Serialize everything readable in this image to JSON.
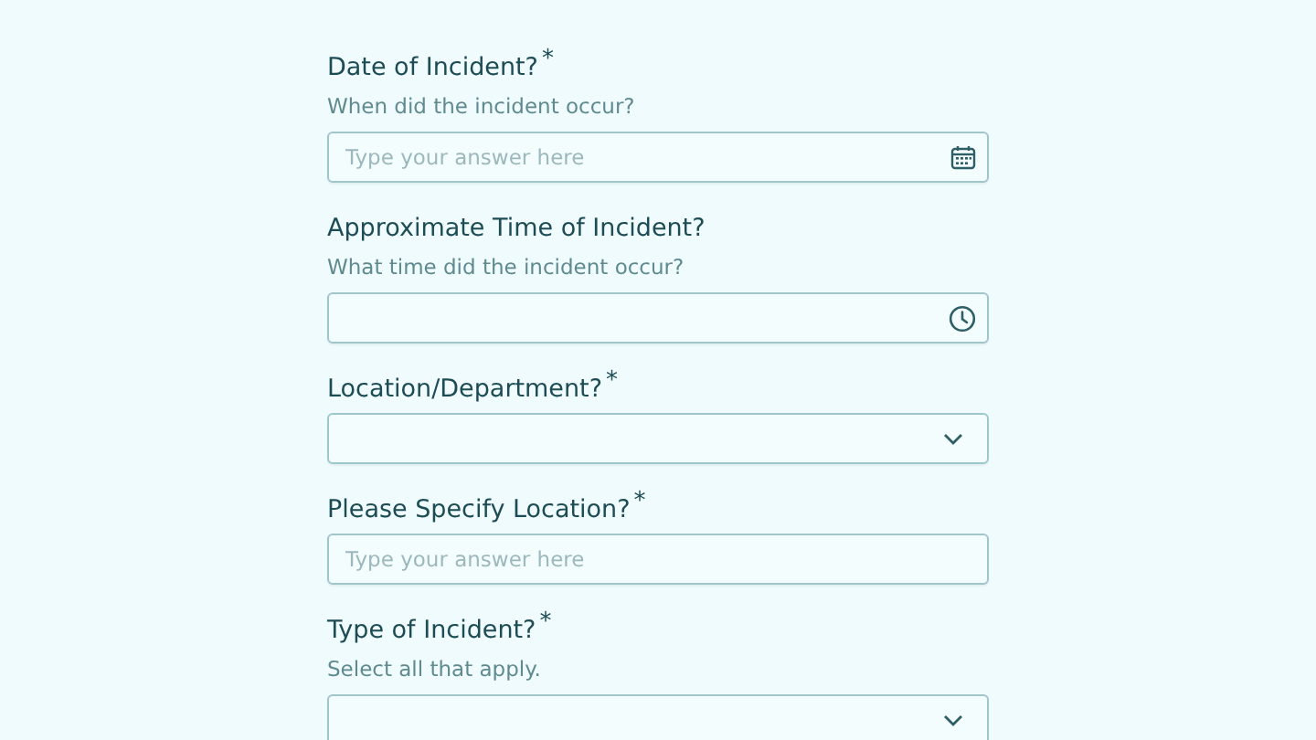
{
  "questions": [
    {
      "label": "Date of Incident?",
      "required_mark": "*",
      "description": "When did the incident occur?",
      "kind": "date",
      "placeholder": "Type your answer here"
    },
    {
      "label": "Approximate Time of Incident?",
      "description": "What time did the incident occur?",
      "kind": "time"
    },
    {
      "label": "Location/Department?",
      "required_mark": "*",
      "kind": "select"
    },
    {
      "label": "Please Specify Location?",
      "required_mark": "*",
      "kind": "text",
      "placeholder": "Type your answer here"
    },
    {
      "label": "Type of Incident?",
      "required_mark": "*",
      "description": "Select all that apply.",
      "kind": "select"
    }
  ]
}
